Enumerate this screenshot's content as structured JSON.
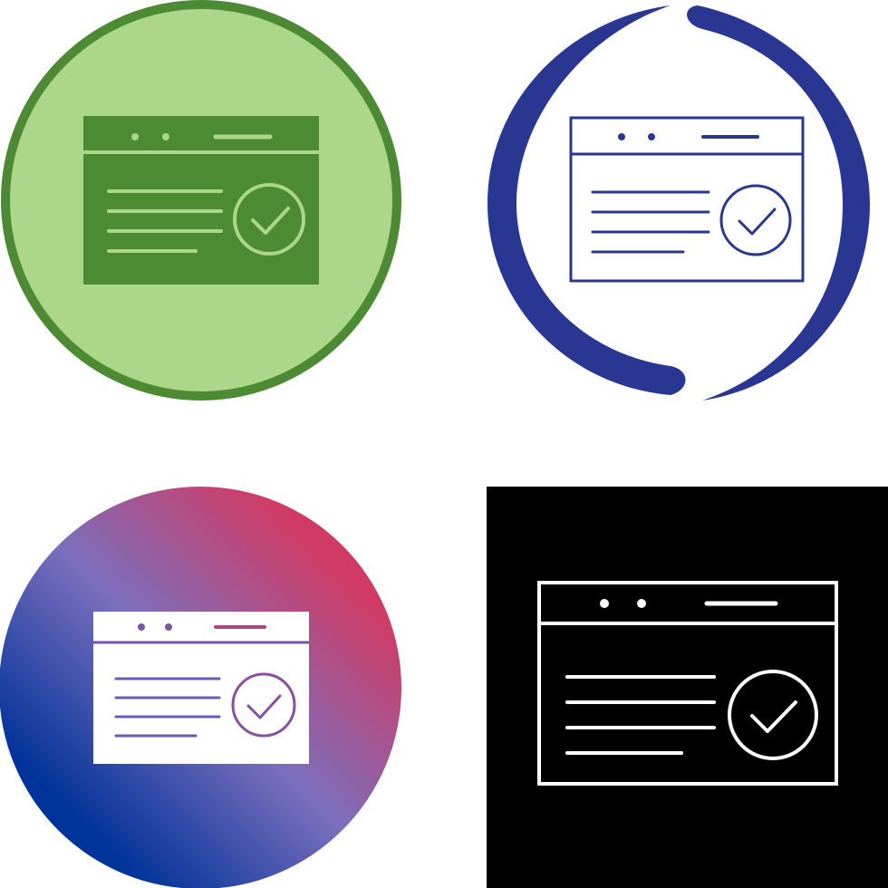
{
  "icon_set": {
    "subject": "browser-window-check-icon",
    "variants": [
      {
        "style": "flat-circle",
        "colors": {
          "background": "#acd68a",
          "ring": "#4c8b34",
          "glyph": "#4c8b34",
          "detail": "#acd68a"
        }
      },
      {
        "style": "outline-arc",
        "colors": {
          "arc": "#2a3792",
          "glyph": "#2a3792"
        }
      },
      {
        "style": "gradient-circle",
        "colors": {
          "gradient": [
            "#003399",
            "#7b6fbd",
            "#d03b65"
          ],
          "glyph": "#ffffff",
          "detail": "#7a55a8"
        }
      },
      {
        "style": "black-square-outline",
        "colors": {
          "background": "#000000",
          "glyph": "#ffffff"
        }
      }
    ]
  }
}
